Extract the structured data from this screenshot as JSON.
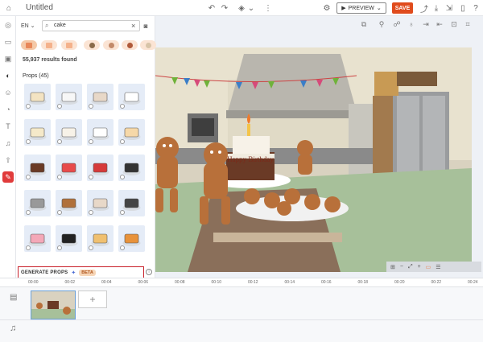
{
  "app": {
    "title": "Untitled"
  },
  "toolbar": {
    "preview_label": "PREVIEW",
    "save_label": "SAVE",
    "accent": "#e04b1c"
  },
  "search": {
    "language": "EN",
    "query": "cake",
    "results": "55,937 results found"
  },
  "props": {
    "heading": "Props (45)",
    "tiles": [
      "cupcake-tray",
      "piping-bag",
      "tiered-cake",
      "cake-sketch",
      "cheese-wedge",
      "round-cake",
      "birthday-cake-candle",
      "cake-slices",
      "chocolate-cake",
      "strawberry-slice",
      "pie-cherries",
      "dark-cake-slice",
      "oven",
      "bread-loaf",
      "cake-stand",
      "knife",
      "strawberry-cupcake",
      "frying-pan",
      "pancakes",
      "orange-pie"
    ]
  },
  "generate": {
    "label": "GENERATE PROPS",
    "badge": "BETA"
  },
  "scene": {
    "banner_text": "Happy Birthday"
  },
  "timeline": {
    "ticks": [
      "00:00",
      "00:02",
      "00:04",
      "00:06",
      "00:08",
      "00:10",
      "00:12",
      "00:14",
      "00:16",
      "00:18",
      "00:20",
      "00:22",
      "00:24"
    ]
  }
}
